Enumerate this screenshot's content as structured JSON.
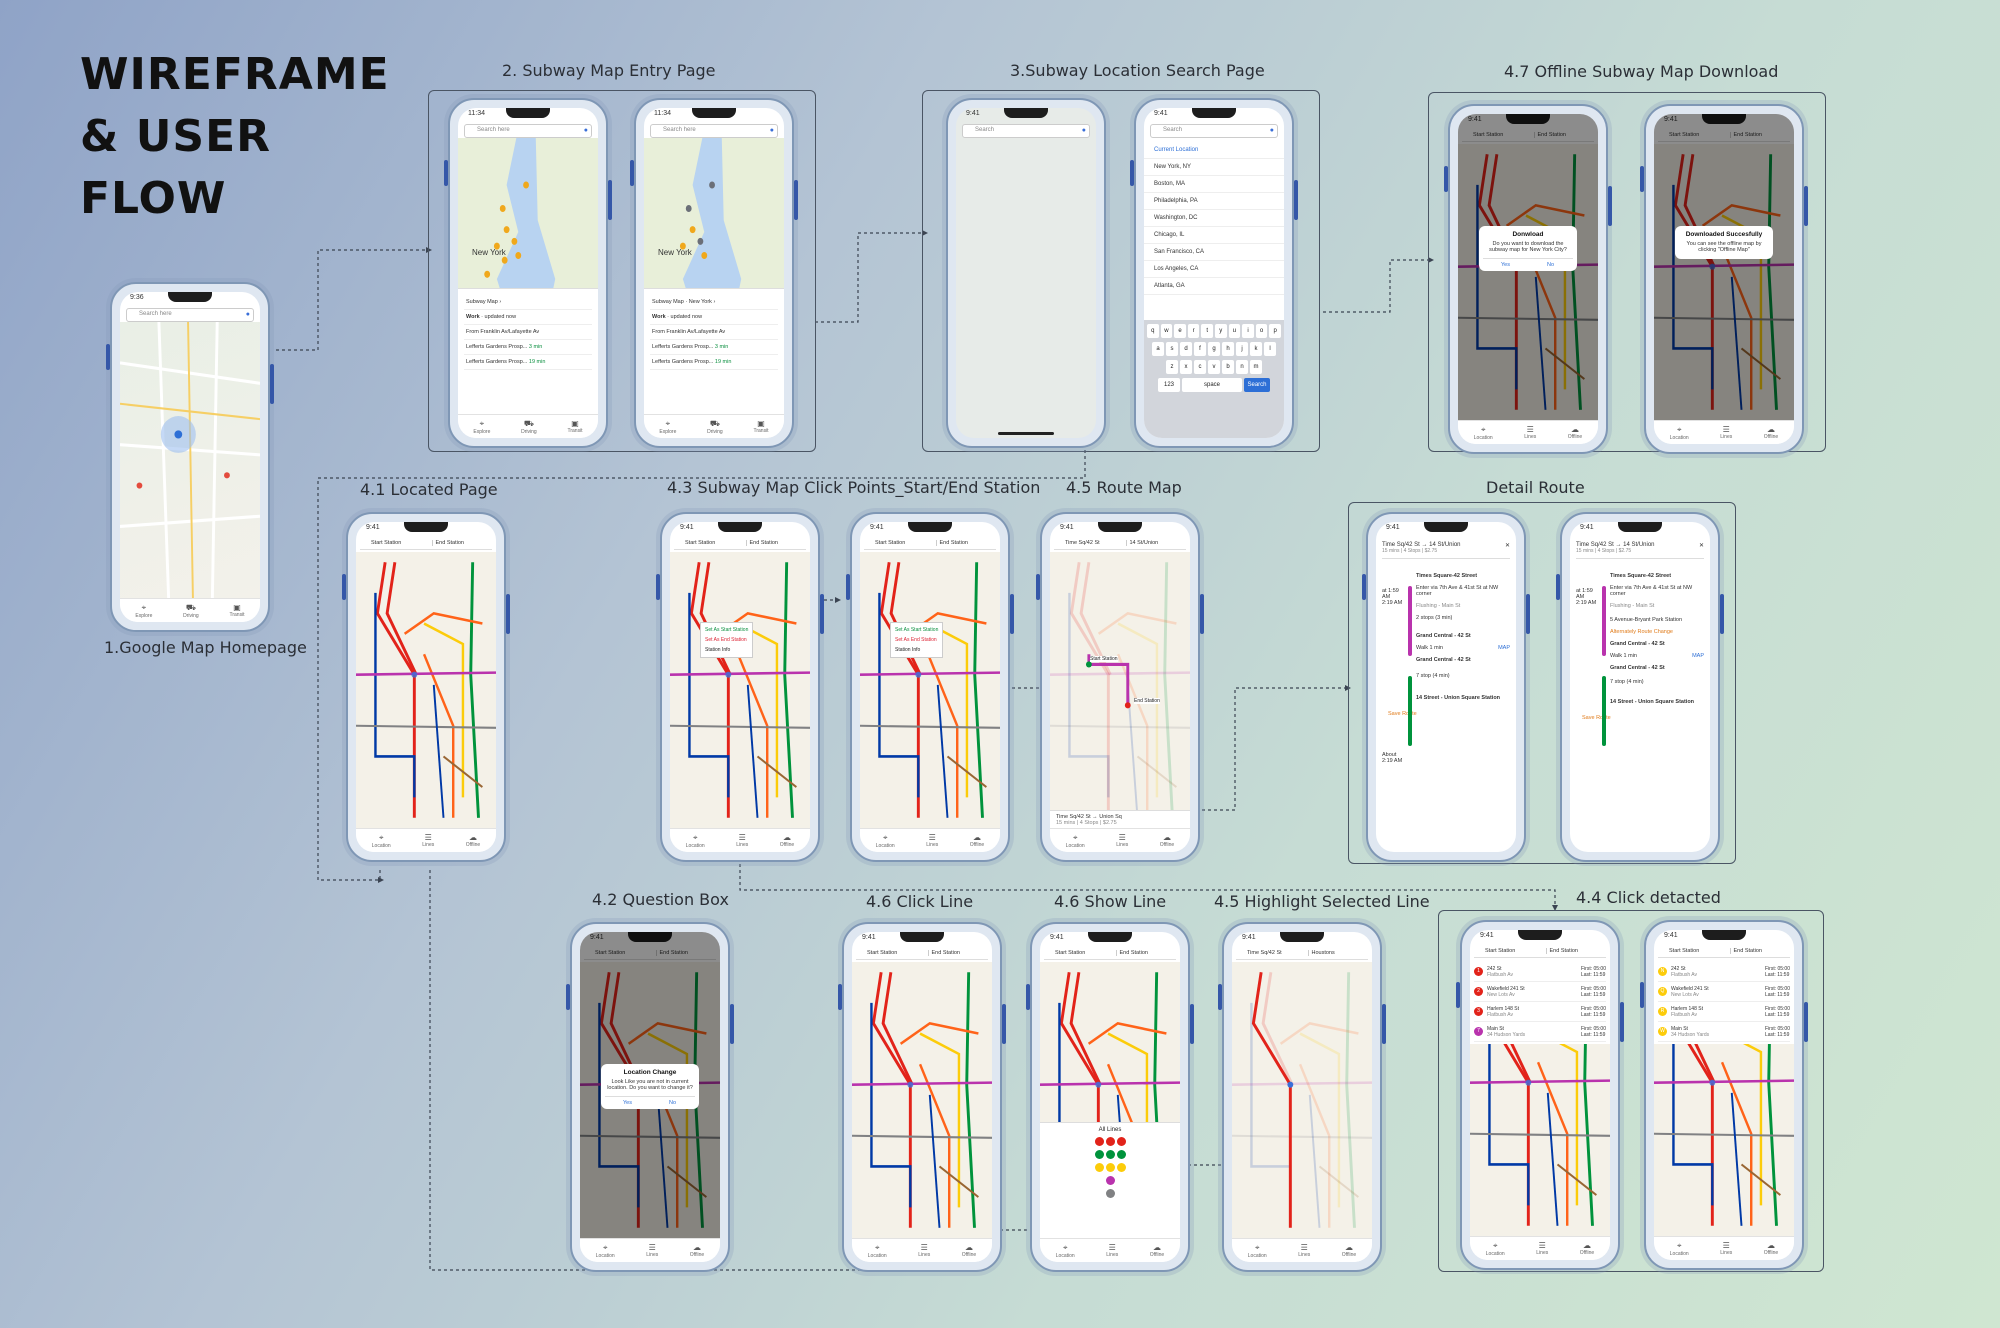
{
  "title_line1": "WIREFRAME",
  "title_line2": "& USER FLOW",
  "labels": {
    "gmap": "1.Google Map Homepage",
    "entry": "2. Subway Map Entry Page",
    "search": "3.Subway Location Search Page",
    "offline": "4.7 Offline Subway Map Download",
    "located": "4.1 Located Page",
    "click_points": "4.3 Subway Map Click Points_Start/End Station",
    "route_map": "4.5 Route Map",
    "detail_route": "Detail Route",
    "question_box": "4.2 Question Box",
    "click_line": "4.6 Click Line",
    "show_line": "4.6 Show Line",
    "highlight": "4.5 Highlight Selected Line",
    "click_detected": "4.4 Click detacted"
  },
  "common": {
    "time": "9:41",
    "time_alt": "9:36",
    "time_entry": "11:34",
    "search_here": "Search here",
    "search_placeholder": "Search",
    "start_station": "Start Station",
    "end_station": "End Station",
    "tab_location": "Location",
    "tab_lines": "Lines",
    "tab_offline": "Offline",
    "tab_explore": "Explore",
    "tab_driving": "Driving",
    "tab_transit": "Transit",
    "new_york": "New York"
  },
  "entry": {
    "subway_map": "Subway Map",
    "subway_map_sub": "New York",
    "work": "Work",
    "updated": "updated now",
    "from": "From Franklin Av/Lafayette Av",
    "route1": "Lefferts Gardens Prosp...",
    "route1_eta": "3 min",
    "route2": "Lefferts Gardens Prosp...",
    "route2_eta": "19 min"
  },
  "search_list": {
    "current": "Current Location",
    "items": [
      "New York, NY",
      "Boston, MA",
      "Philadelphia, PA",
      "Washington, DC",
      "Chicago, IL",
      "San Francisco, CA",
      "Los Angeles, CA",
      "Atlanta, GA"
    ],
    "row1": [
      "q",
      "w",
      "e",
      "r",
      "t",
      "y",
      "u",
      "i",
      "o",
      "p"
    ],
    "row2": [
      "a",
      "s",
      "d",
      "f",
      "g",
      "h",
      "j",
      "k",
      "l"
    ],
    "row3": [
      "z",
      "x",
      "c",
      "v",
      "b",
      "n",
      "m"
    ],
    "key_123": "123",
    "key_space": "space",
    "key_search": "Search"
  },
  "dialogs": {
    "download_title": "Donwload",
    "download_body": "Do you want to download the subway map for New York City?",
    "yes": "Yes",
    "no": "No",
    "downloaded_title": "Downloaded Succesfully",
    "downloaded_body": "You can see the offline map by clicking \"Offline Map\"",
    "location_title": "Location Change",
    "location_body": "Look Like you are not in current location. Do you want to change it?"
  },
  "popup": {
    "set_start": "Set As Start Station",
    "set_end": "Set As End Station",
    "info": "Station Info"
  },
  "route": {
    "from": "Time Sq/42 St",
    "to": "14 St/Union",
    "to_full": "Union Sq",
    "summary": "15 mins | 4 Stops | $2.75",
    "start_marker": "Start Station",
    "end_marker": "End Station"
  },
  "detail": {
    "stop1": "Times Square-42 Street",
    "stop1_sub": "Enter via 7th Ave & 41st St at NW corner",
    "flushing": "Flushing - Main St",
    "stops2": "2 stops (3 min)",
    "gc": "Grand Central - 42 St",
    "walk": "Walk 1 min",
    "map": "MAP",
    "stops7": "7 stop (4 min)",
    "end": "14 Street - Union Square Station",
    "save": "Save Route",
    "alt_stop": "5 Avenue-Bryant Park Station",
    "alt_change": "Alternately Route Change",
    "t1": "at 1:59 AM",
    "t2": "2:19 AM",
    "about": "About",
    "t3": "2:19 AM"
  },
  "lines_panel": {
    "title": "All Lines"
  },
  "highlight": {
    "from": "Time Sq/42 St",
    "to": "Houstons"
  },
  "schedule": {
    "rows": [
      {
        "name": "242 St",
        "sub": "Flatbush Av",
        "first": "First: 05:00",
        "last": "Last: 11:59"
      },
      {
        "name": "Wakefield 241 St",
        "sub": "New Lots Av",
        "first": "First: 05:00",
        "last": "Last: 11:59"
      },
      {
        "name": "Harlem 148 St",
        "sub": "Flatbush Av",
        "first": "First: 05:00",
        "last": "Last: 11:59"
      },
      {
        "name": "Main St",
        "sub": "34 Hudson Yards",
        "first": "First: 05:00",
        "last": "Last: 11:59"
      }
    ],
    "badges1": [
      "1",
      "2",
      "3",
      "7"
    ],
    "badges2": [
      "N",
      "Q",
      "R",
      "W"
    ]
  },
  "colors": {
    "red": "#e2231a",
    "green": "#00933c",
    "blue": "#0039a6",
    "orange": "#ff6319",
    "yellow": "#fccc0a",
    "purple": "#b933ad",
    "brown": "#996633",
    "gray": "#808183",
    "accent": "#2d6fd6"
  }
}
